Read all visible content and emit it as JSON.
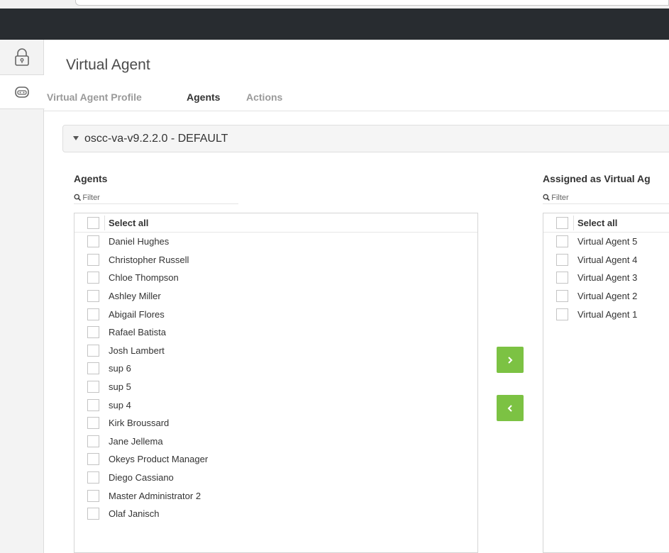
{
  "page": {
    "title": "Virtual Agent"
  },
  "tabs": [
    {
      "label": "Virtual Agent Profile",
      "active": false
    },
    {
      "label": "Agents",
      "active": true
    },
    {
      "label": "Actions",
      "active": false
    }
  ],
  "sidebar": {
    "icons": [
      "lock-icon",
      "robot-icon"
    ]
  },
  "profile": {
    "name": "oscc-va-v9.2.2.0 - DEFAULT"
  },
  "agents_panel": {
    "title": "Agents",
    "filter_placeholder": "Filter",
    "select_all": "Select all",
    "items": [
      "Daniel Hughes",
      "Christopher Russell",
      "Chloe Thompson",
      "Ashley Miller",
      "Abigail Flores",
      "Rafael Batista",
      "Josh Lambert",
      "sup 6",
      "sup 5",
      "sup 4",
      "Kirk Broussard",
      "Jane Jellema",
      "Okeys Product Manager",
      "Diego Cassiano",
      "Master Administrator 2",
      "Olaf Janisch"
    ]
  },
  "assigned_panel": {
    "title": "Assigned as Virtual Ag",
    "filter_placeholder": "Filter",
    "select_all": "Select all",
    "items": [
      "Virtual Agent 5",
      "Virtual Agent 4",
      "Virtual Agent 3",
      "Virtual Agent 2",
      "Virtual Agent 1"
    ]
  },
  "buttons": {
    "move_right": "›",
    "move_left": "‹"
  },
  "colors": {
    "topbar": "#282c30",
    "accent_green": "#7cc243"
  }
}
